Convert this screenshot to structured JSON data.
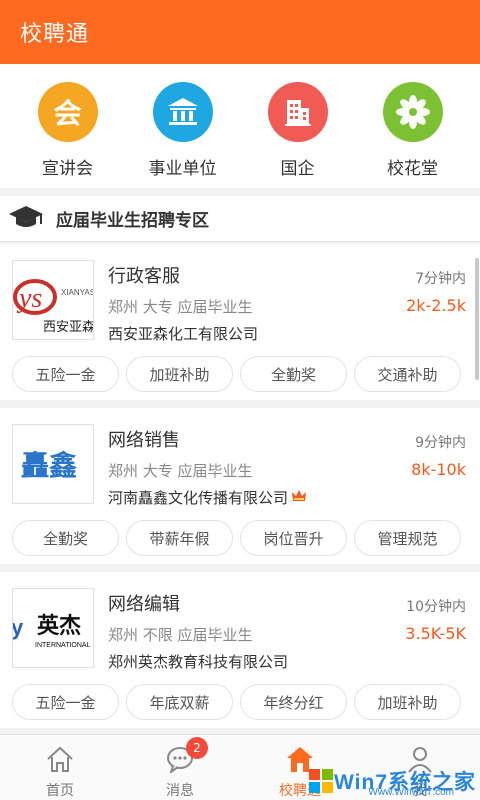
{
  "header": {
    "title": "校聘通"
  },
  "categories": [
    {
      "label": "宣讲会",
      "glyph": "会",
      "color": "#f5a623",
      "icon": "presentation-icon"
    },
    {
      "label": "事业单位",
      "glyph": "",
      "color": "#1ea7e0",
      "icon": "institution-building-icon"
    },
    {
      "label": "国企",
      "glyph": "",
      "color": "#f25a56",
      "icon": "state-enterprise-building-icon"
    },
    {
      "label": "校花堂",
      "glyph": "",
      "color": "#7cc134",
      "icon": "flower-icon"
    }
  ],
  "section": {
    "title": "应届毕业生招聘专区",
    "icon": "graduation-cap-icon"
  },
  "jobs": [
    {
      "title": "行政客服",
      "meta": "郑州 大专 应届毕业生",
      "company": "西安亚森化工有限公司",
      "time": "7分钟内",
      "salary": "2k-2.5k",
      "vip": false,
      "logo": {
        "main": "西安亚森",
        "small": "XIANYAS",
        "mark": "ys"
      },
      "tags": [
        "五险一金",
        "加班补助",
        "全勤奖",
        "交通补助"
      ]
    },
    {
      "title": "网络销售",
      "meta": "郑州 大专 应届毕业生",
      "company": "河南矗鑫文化传播有限公司",
      "time": "9分钟内",
      "salary": "8k-10k",
      "vip": true,
      "logo": {
        "main": "矗鑫"
      },
      "tags": [
        "全勤奖",
        "带薪年假",
        "岗位晋升",
        "管理规范"
      ]
    },
    {
      "title": "网络编辑",
      "meta": "郑州 不限 应届毕业生",
      "company": "郑州英杰教育科技有限公司",
      "time": "10分钟内",
      "salary": "3.5K-5K",
      "vip": false,
      "logo": {
        "main": "英杰",
        "small": "INTERNATIONAL",
        "mark": "y"
      },
      "tags": [
        "五险一金",
        "年底双薪",
        "年终分红",
        "加班补助"
      ]
    }
  ],
  "tabbar": {
    "tabs": [
      {
        "label": "首页",
        "icon": "home-icon"
      },
      {
        "label": "消息",
        "icon": "message-icon",
        "badge": "2"
      },
      {
        "label": "校聘通",
        "icon": "campus-hire-icon",
        "active": true
      },
      {
        "label": "我",
        "icon": "profile-icon"
      }
    ]
  },
  "watermark": {
    "brand": "Win7系统之家",
    "url": "Www.Winwin7.com"
  },
  "colors": {
    "brand": "#ff6a21",
    "salary": "#f25a1d"
  }
}
